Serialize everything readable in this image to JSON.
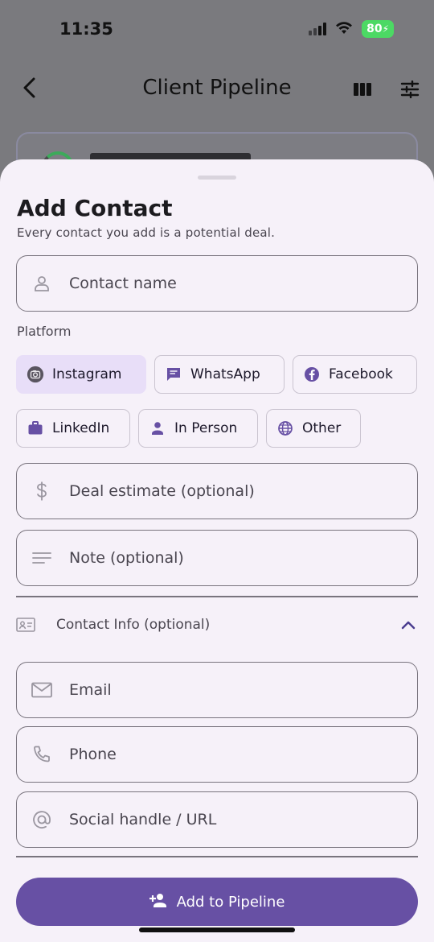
{
  "status_bar": {
    "time": "11:35",
    "battery": "80"
  },
  "header": {
    "title": "Client Pipeline"
  },
  "sheet": {
    "title": "Add Contact",
    "subtitle": "Every contact you add is a potential deal.",
    "contact_name_placeholder": "Contact name",
    "platform_label": "Platform",
    "platforms": [
      {
        "label": "Instagram",
        "icon": "camera-icon",
        "selected": true
      },
      {
        "label": "WhatsApp",
        "icon": "chat-icon",
        "selected": false
      },
      {
        "label": "Facebook",
        "icon": "facebook-icon",
        "selected": false
      },
      {
        "label": "LinkedIn",
        "icon": "briefcase-icon",
        "selected": false
      },
      {
        "label": "In Person",
        "icon": "person-icon",
        "selected": false
      },
      {
        "label": "Other",
        "icon": "globe-icon",
        "selected": false
      }
    ],
    "deal_placeholder": "Deal estimate (optional)",
    "note_placeholder": "Note (optional)",
    "contact_info_label": "Contact Info (optional)",
    "email_placeholder": "Email",
    "phone_placeholder": "Phone",
    "social_placeholder": "Social handle / URL",
    "submit_label": "Add to Pipeline"
  },
  "colors": {
    "accent": "#6750a4",
    "selected_chip": "#e8def8",
    "sheet_bg": "#f6f1f9",
    "scrim": "#7a7a7e",
    "battery": "#4cd964"
  }
}
